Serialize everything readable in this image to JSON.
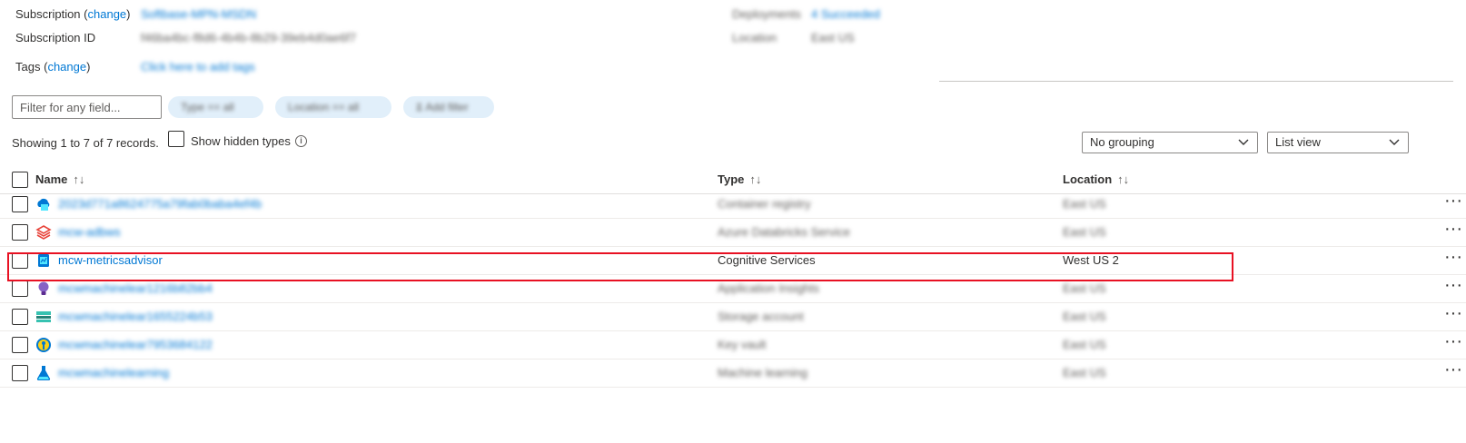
{
  "essentials": {
    "subscription_label": "Subscription",
    "subscription_change": "change",
    "subscription_value": "Softbase-MPN-MSDN",
    "subscription_id_label": "Subscription ID",
    "subscription_id_value": "f46ba4bc-f8d6-4b4b-8b29-39eb4d0ae6f7",
    "tags_label": "Tags",
    "tags_change": "change",
    "tags_value": "Click here to add tags",
    "deployments_label": "Deployments",
    "deployments_value": "4 Succeeded",
    "location_label": "Location",
    "location_value": "East US"
  },
  "filters": {
    "search_placeholder": "Filter for any field...",
    "type_pill": "Type == all",
    "location_pill": "Location == all",
    "add_filter": "Add filter"
  },
  "list_info": {
    "records": "Showing 1 to 7 of 7 records.",
    "show_hidden": "Show hidden types",
    "grouping": "No grouping",
    "view": "List view"
  },
  "table": {
    "headers": {
      "name": "Name",
      "type": "Type",
      "location": "Location"
    },
    "rows": [
      {
        "name": "2023d771a8624775a79fab0baba4ef4b",
        "type": "Container registry",
        "location": "East US",
        "icon": "container-registry-icon",
        "blurred": true
      },
      {
        "name": "mcw-adbws",
        "type": "Azure Databricks Service",
        "location": "East US",
        "icon": "databricks-icon",
        "blurred": true
      },
      {
        "name": "mcw-metricsadvisor",
        "type": "Cognitive Services",
        "location": "West US 2",
        "icon": "cognitive-services-icon",
        "blurred": false
      },
      {
        "name": "mcwmachinelear1216b82bb4",
        "type": "Application Insights",
        "location": "East US",
        "icon": "app-insights-icon",
        "blurred": true
      },
      {
        "name": "mcwmachinelear1655224b53",
        "type": "Storage account",
        "location": "East US",
        "icon": "storage-account-icon",
        "blurred": true
      },
      {
        "name": "mcwmachinelear7953684122",
        "type": "Key vault",
        "location": "East US",
        "icon": "key-vault-icon",
        "blurred": true
      },
      {
        "name": "mcwmachinelearning",
        "type": "Machine learning",
        "location": "East US",
        "icon": "machine-learning-icon",
        "blurred": true
      }
    ]
  },
  "colors": {
    "link": "#0078d4",
    "highlight": "#e81123",
    "pill_bg": "#e1effa"
  }
}
